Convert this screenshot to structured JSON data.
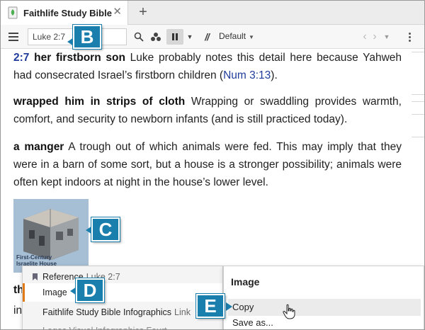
{
  "tab": {
    "title": "Faithlife Study Bible",
    "close_glyph": "✕",
    "new_tab_glyph": "+",
    "icon": "faithlife-book-icon"
  },
  "toolbar": {
    "reference_value": "Luke 2:7",
    "view_label": "Default",
    "parallel_glyph": "//",
    "icons": [
      "menu-icon",
      "search-icon",
      "visual-filter-icon",
      "panel-layout-icon",
      "parallel-resources-icon",
      "back-arrow-icon",
      "forward-arrow-icon",
      "more-icon"
    ]
  },
  "content": {
    "p1": {
      "verse": "2:7",
      "term": "her firstborn son",
      "text_a": " Luke probably notes this detail here because Yahweh had consecrated Israel’s firstborn children (",
      "xref": "Num 3:13",
      "text_b": ")."
    },
    "p2": {
      "term": "wrapped him in strips of cloth",
      "text": " Wrapping or swaddling provides warmth, comfort, and security to newborn infants (and is still practiced today)."
    },
    "p3": {
      "term": "a manger",
      "text": " A trough out of which animals were fed. This may imply that they were in a barn of some sort, but a house is a stronger possibility; animals were often kept indoors at night in the house’s lower level."
    },
    "image_caption_line1": "First-Century",
    "image_caption_line2": "Israelite House",
    "frag1": "th",
    "frag2": "in"
  },
  "context_menu": {
    "left": {
      "reference_label": "Reference",
      "reference_value": "Luke 2:7",
      "image_label": "Image",
      "infographics_label": "Faithlife Study Bible Infographics",
      "infographics_suffix": "Link",
      "cut_off_row": "Logos Visual Infographics Fourt…"
    },
    "right": {
      "header": "Image",
      "copy": "Copy",
      "save_as": "Save as..."
    }
  },
  "callouts": {
    "b": "B",
    "c": "C",
    "d": "D",
    "e": "E"
  },
  "colors": {
    "callout_bg": "#1b7fae",
    "verse_link": "#1f3c9c",
    "menu_selected_accent": "#e07b18"
  }
}
